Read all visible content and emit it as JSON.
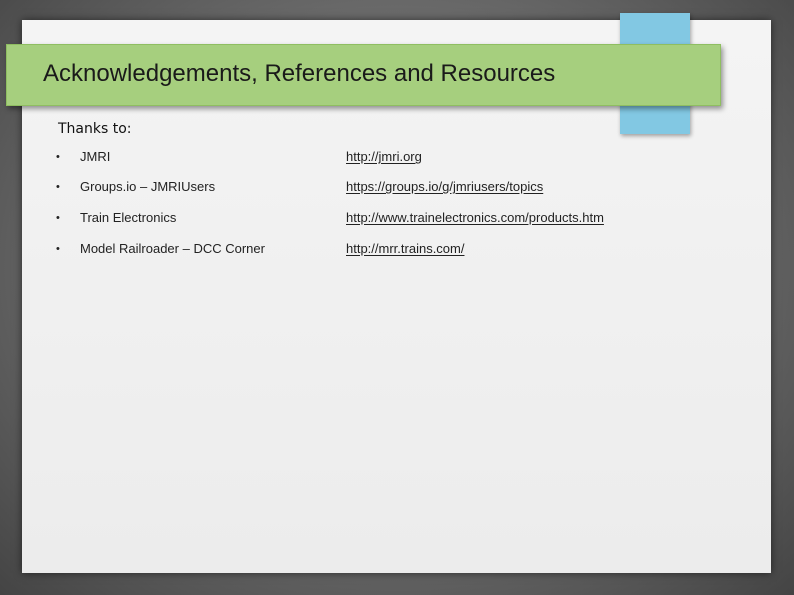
{
  "header": {
    "title": "Acknowledgements, References and Resources"
  },
  "content": {
    "subheading": "Thanks to:",
    "bullet_glyph": "•",
    "items": [
      {
        "label": "JMRI",
        "url": "http://jmri.org"
      },
      {
        "label": "Groups.io – JMRIUsers",
        "url": "https://groups.io/g/jmriusers/topics"
      },
      {
        "label": "Train Electronics",
        "url": "http://www.trainelectronics.com/products.htm"
      },
      {
        "label": "Model Railroader – DCC Corner",
        "url": "http://mrr.trains.com/"
      }
    ]
  },
  "colors": {
    "title_band": "#a6cf7e",
    "accent_tab": "#82c8e3",
    "slide_background": "#f0f0f0"
  }
}
